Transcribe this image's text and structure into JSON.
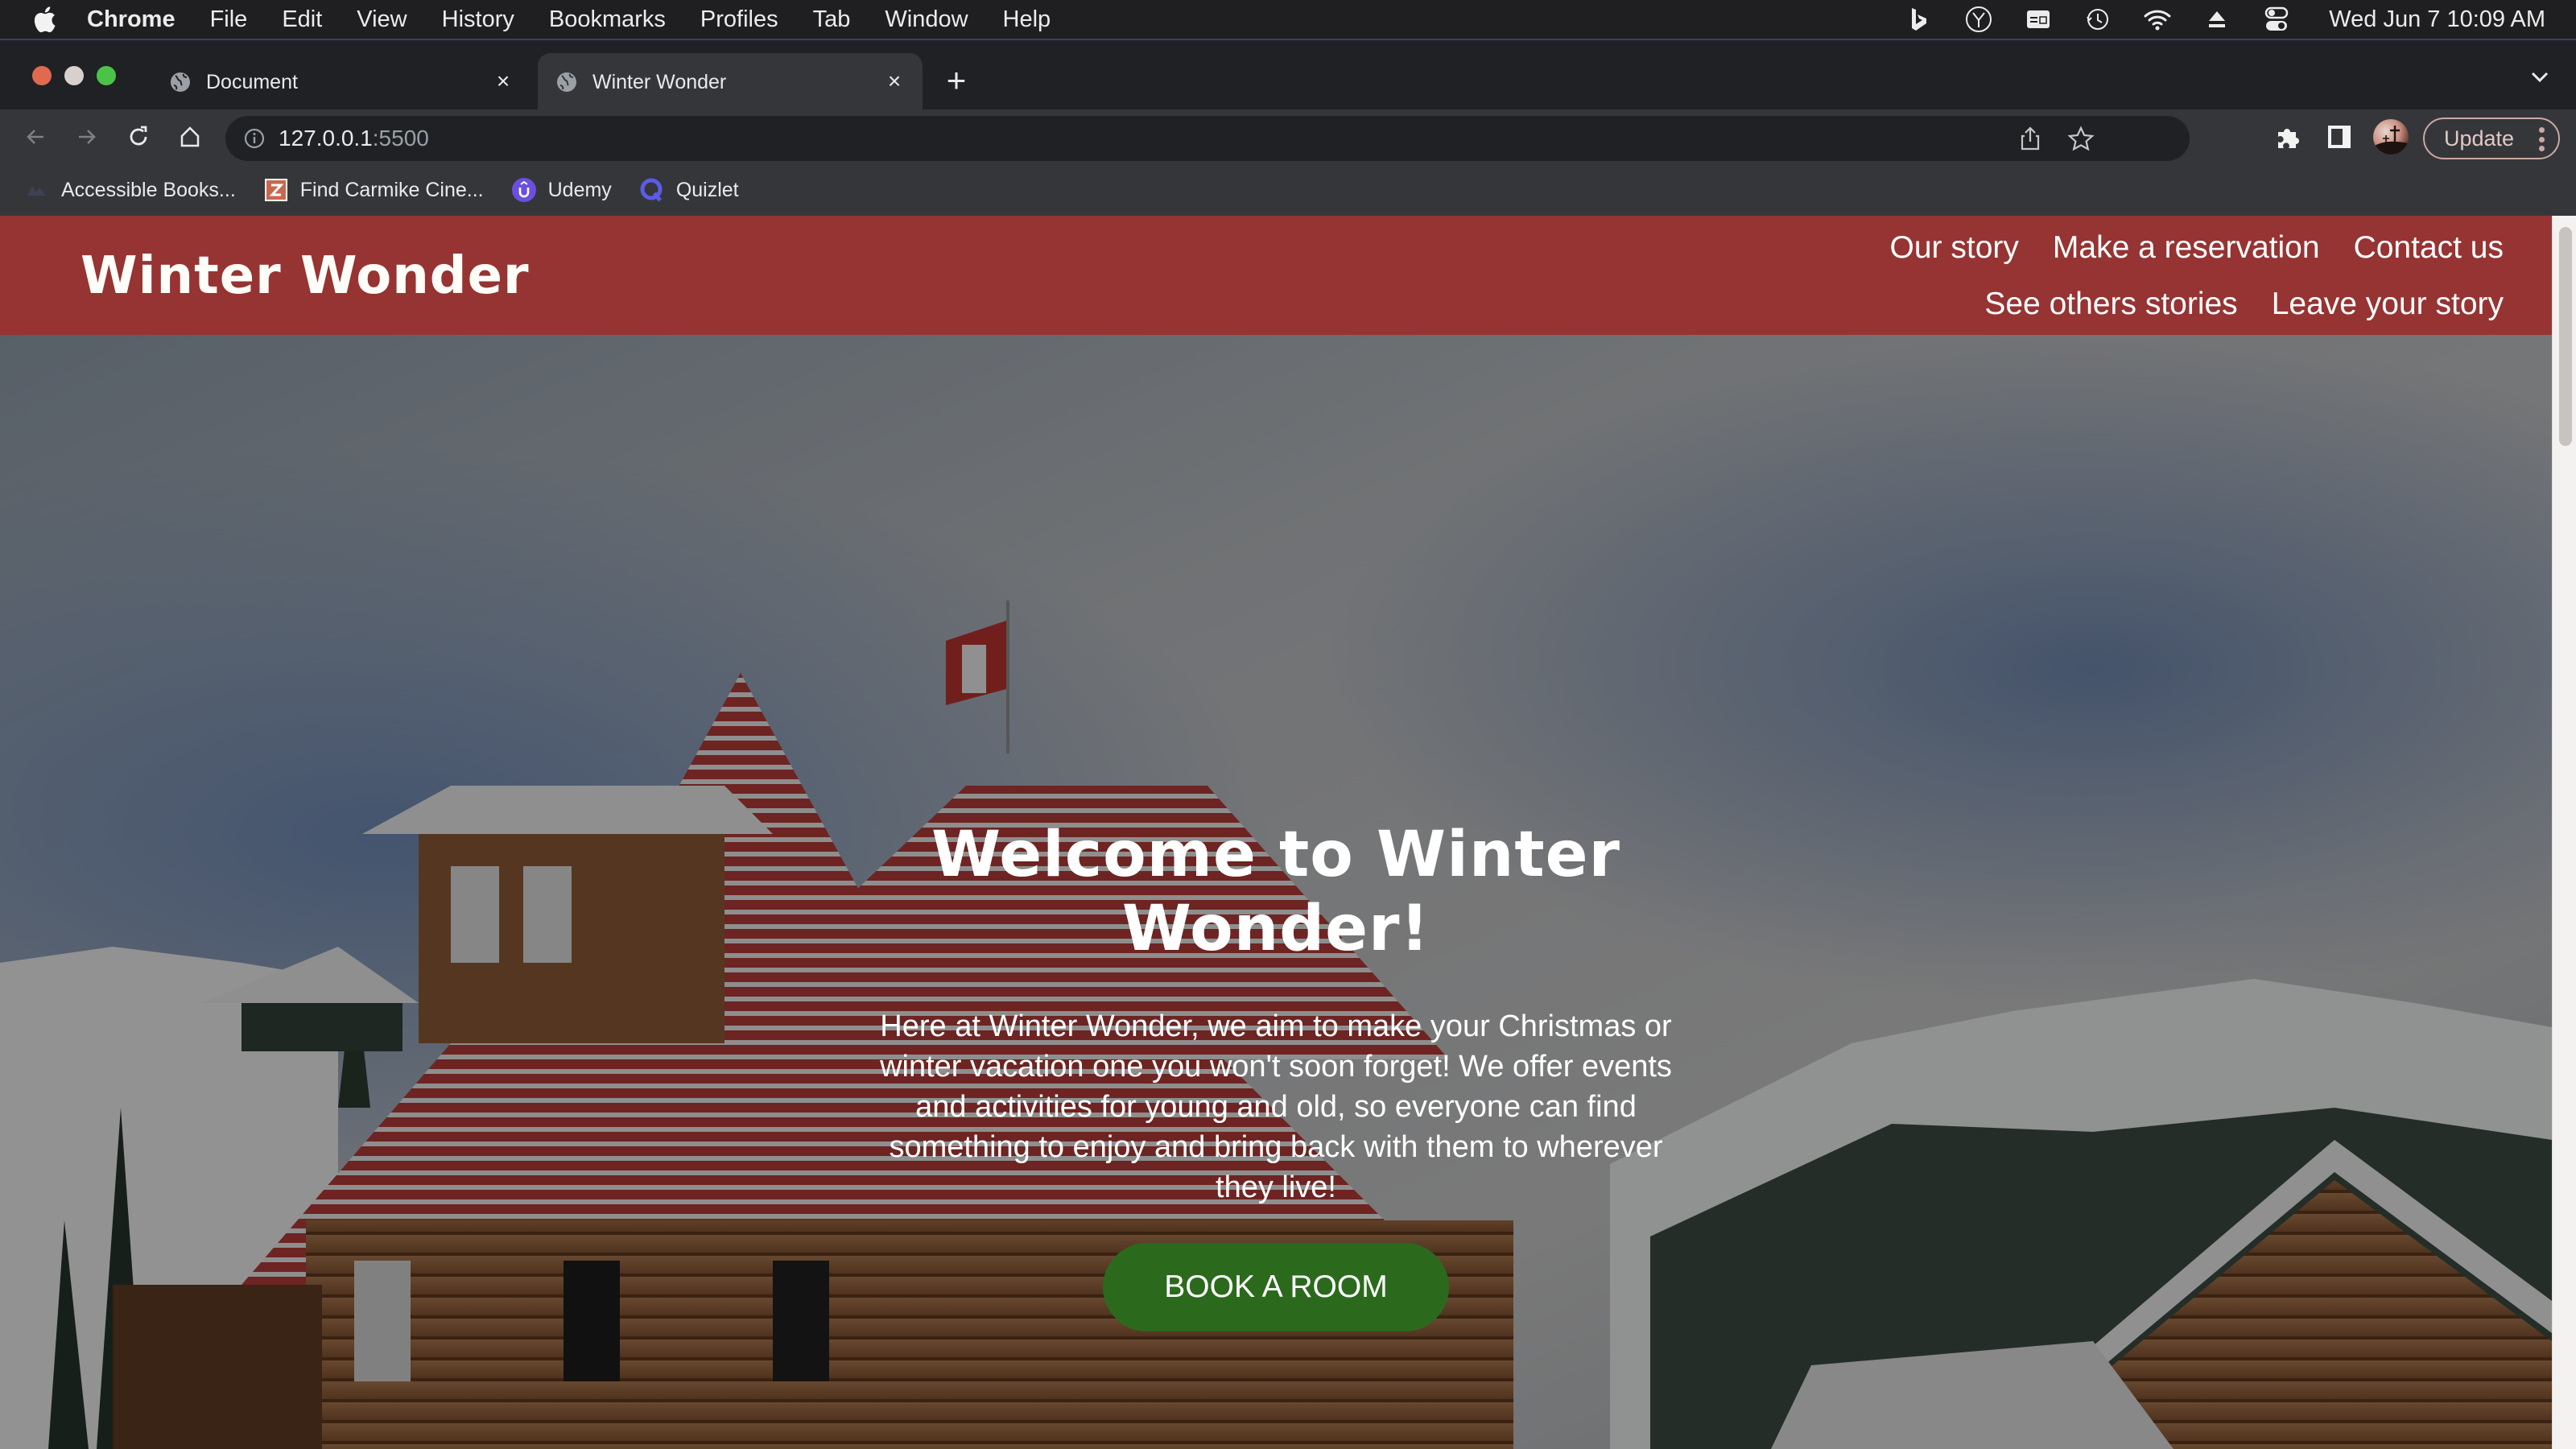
{
  "menubar": {
    "app_name": "Chrome",
    "items": [
      "File",
      "Edit",
      "View",
      "History",
      "Bookmarks",
      "Profiles",
      "Tab",
      "Window",
      "Help"
    ],
    "status_icons": [
      "bing-icon",
      "clock-app-icon",
      "keyboard-shortcut-icon",
      "time-machine-icon",
      "wifi-icon",
      "eject-icon",
      "control-center-icon"
    ],
    "clock": "Wed Jun 7  10:09 AM"
  },
  "browser": {
    "tabs": [
      {
        "title": "Document",
        "active": false
      },
      {
        "title": "Winter Wonder",
        "active": true
      }
    ],
    "url_host": "127.0.0.1",
    "url_port": ":5500",
    "update_label": "Update",
    "bookmarks": [
      {
        "label": "Accessible Books...",
        "icon": "accessible-books-icon"
      },
      {
        "label": "Find Carmike Cine...",
        "icon": "carmike-icon"
      },
      {
        "label": "Udemy",
        "icon": "udemy-icon"
      },
      {
        "label": "Quizlet",
        "icon": "quizlet-icon"
      }
    ]
  },
  "site": {
    "logo": "Winter Wonder",
    "nav": [
      "Our story",
      "Make a reservation",
      "Contact us",
      "See others stories",
      "Leave your story"
    ],
    "hero": {
      "title": "Welcome to Winter Wonder!",
      "text": "Here at Winter Wonder, we aim to make your Christmas or winter vacation one you won't soon forget! We offer events and activities for young and old, so everyone can find something to enjoy and bring back with them to wherever they live!",
      "cta": "BOOK A ROOM"
    },
    "colors": {
      "header": "#963433",
      "cta": "#2b6a1d"
    }
  }
}
